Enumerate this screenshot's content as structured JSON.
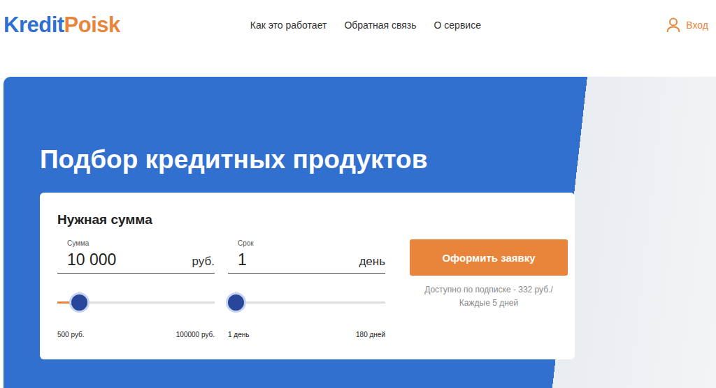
{
  "logo": {
    "part1": "Kredit",
    "part2": "Poisk"
  },
  "nav": [
    "Как это работает",
    "Обратная связь",
    "О сервисе"
  ],
  "login": "Вход",
  "hero": {
    "title": "Подбор кредитных продуктов"
  },
  "form": {
    "title": "Нужная сумма",
    "fields": [
      {
        "label": "Сумма",
        "value": "10 000",
        "unit": "руб.",
        "level": 0.1,
        "min": "500 руб.",
        "max": "100000 руб."
      },
      {
        "label": "Срок",
        "value": "1",
        "unit": "день",
        "level": 0,
        "min": "1 день",
        "max": "180 дней"
      }
    ],
    "button": "Оформить заявку",
    "note": "Доступно по подписке - 332 руб./Каждые 5 дней"
  }
}
